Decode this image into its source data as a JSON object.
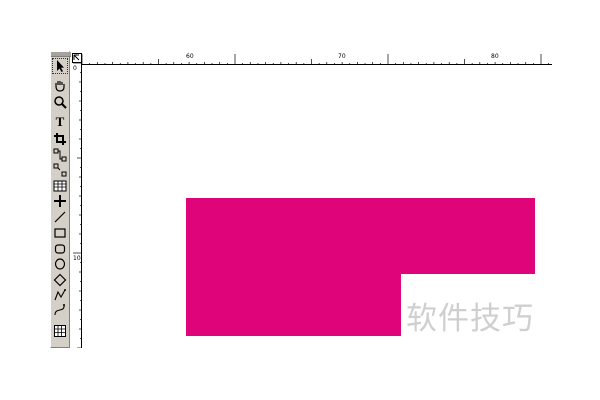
{
  "toolbox": {
    "tools": [
      {
        "name": "selection-tool",
        "icon": "arrow-icon"
      },
      {
        "name": "hand-tool",
        "icon": "hand-icon"
      },
      {
        "name": "zoom-tool",
        "icon": "magnifier-icon"
      },
      {
        "name": "text-tool",
        "icon": "text-icon",
        "glyph": "T"
      },
      {
        "name": "crop-tool",
        "icon": "crop-icon"
      },
      {
        "name": "link-tool",
        "icon": "link-icon"
      },
      {
        "name": "unlink-tool",
        "icon": "unlink-icon"
      },
      {
        "name": "table-tool",
        "icon": "table-icon"
      },
      {
        "name": "cross-tool",
        "icon": "crosshair-icon"
      },
      {
        "name": "line-tool",
        "icon": "line-icon"
      },
      {
        "name": "rectangle-tool",
        "icon": "rectangle-icon"
      },
      {
        "name": "rounded-rectangle-tool",
        "icon": "rounded-rectangle-icon"
      },
      {
        "name": "oval-tool",
        "icon": "oval-icon"
      },
      {
        "name": "diamond-tool",
        "icon": "diamond-icon"
      },
      {
        "name": "freehand-tool",
        "icon": "freehand-icon"
      },
      {
        "name": "bezier-tool",
        "icon": "bezier-icon"
      },
      {
        "name": "grid-tool",
        "icon": "grid-icon"
      }
    ]
  },
  "ruler": {
    "horizontal_labels": [
      "60",
      "70",
      "80"
    ],
    "vertical_labels": [
      "0",
      "10"
    ]
  },
  "artwork": {
    "fill_color": "#e0047a"
  },
  "watermark": {
    "text": "软件技巧"
  }
}
